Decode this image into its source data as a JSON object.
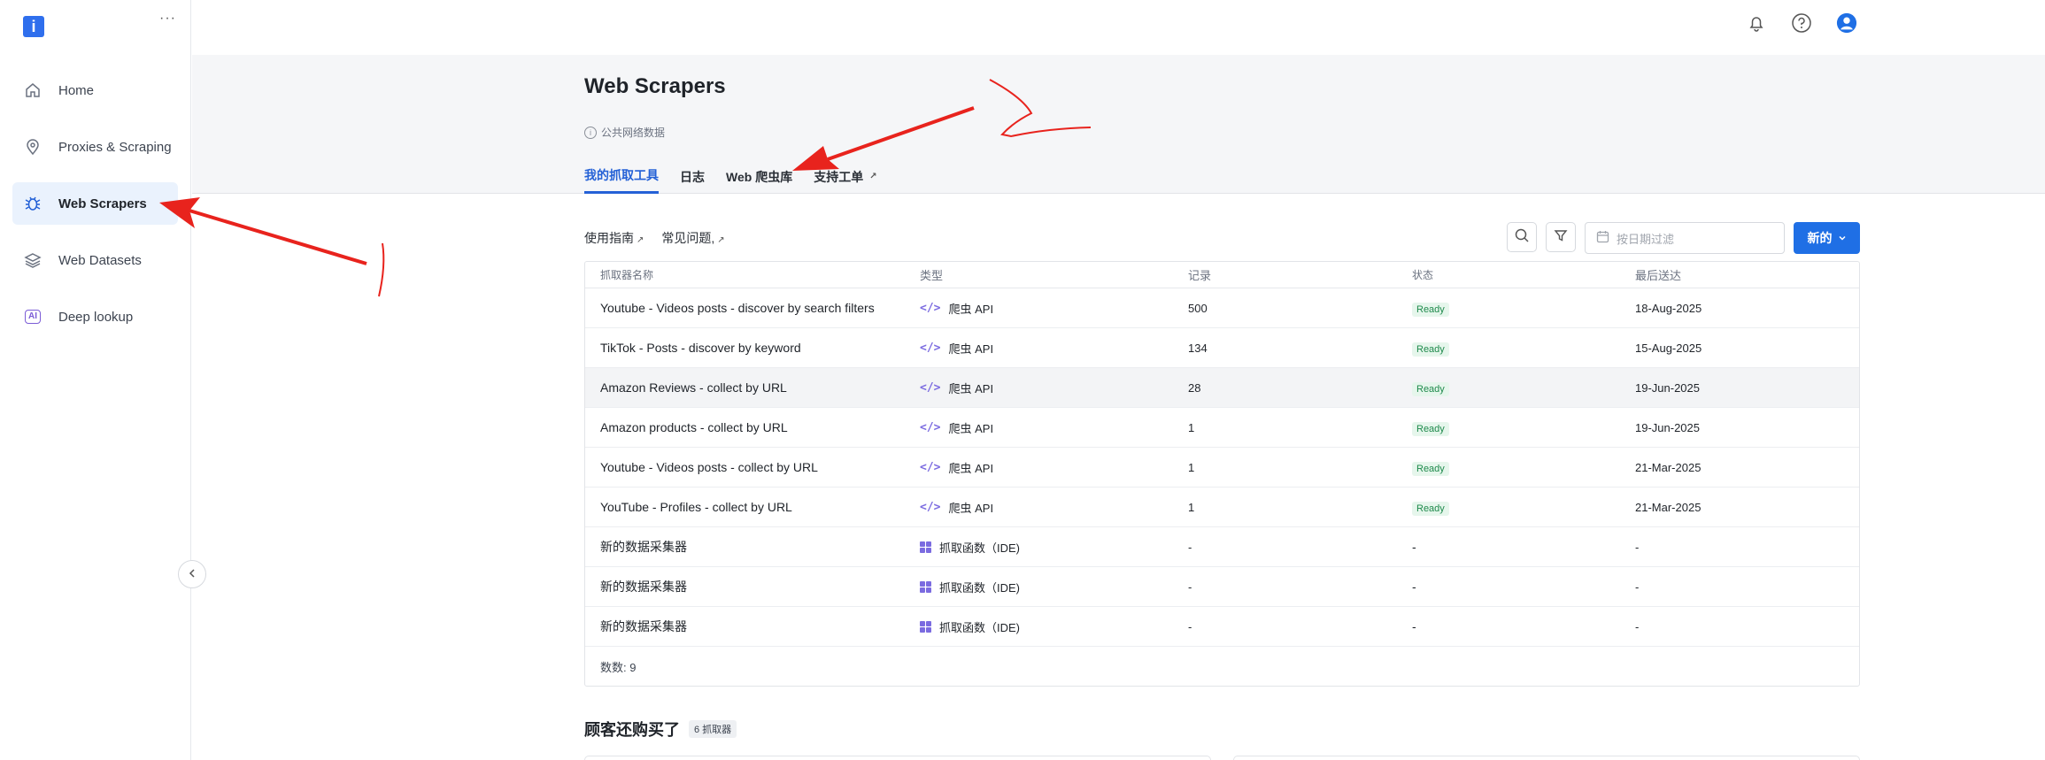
{
  "sidebar": {
    "logo_icon": "info-logo-icon",
    "more_icon": "more-dots-icon",
    "items": [
      {
        "label": "Home",
        "icon": "home-icon",
        "active": false
      },
      {
        "label": "Proxies & Scraping",
        "icon": "location-pin-icon",
        "active": false
      },
      {
        "label": "Web Scrapers",
        "icon": "bug-icon",
        "active": true
      },
      {
        "label": "Web Datasets",
        "icon": "layers-icon",
        "active": false
      },
      {
        "label": "Deep lookup",
        "icon": "ai-icon",
        "active": false
      }
    ],
    "ai_glyph": "AI",
    "collapse_icon": "chevron-left-icon"
  },
  "topbar": {
    "icons": [
      "bell-icon",
      "help-icon",
      "user-avatar-icon"
    ]
  },
  "header": {
    "title": "Web Scrapers",
    "subtitle": "公共网络数据",
    "tabs": [
      {
        "label": "我的抓取工具",
        "active": true,
        "external": false
      },
      {
        "label": "日志",
        "active": false,
        "external": false
      },
      {
        "label": "Web 爬虫库",
        "active": false,
        "external": false
      },
      {
        "label": "支持工单",
        "active": false,
        "external": true
      }
    ]
  },
  "toolbar": {
    "links": [
      "使用指南",
      "常见问题,"
    ],
    "date_placeholder": "按日期过滤",
    "new_label": "新的",
    "accent": "#1f6fe5"
  },
  "table": {
    "columns": [
      "抓取器名称",
      "类型",
      "记录",
      "状态",
      "最后送达"
    ],
    "rows": [
      {
        "name": "Youtube - Videos posts - discover by search filters",
        "type": "爬虫 API",
        "type_icon": "code-icon",
        "records": "500",
        "status": "Ready",
        "last": "18-Aug-2025"
      },
      {
        "name": "TikTok - Posts - discover by keyword",
        "type": "爬虫 API",
        "type_icon": "code-icon",
        "records": "134",
        "status": "Ready",
        "last": "15-Aug-2025"
      },
      {
        "name": "Amazon Reviews - collect by URL",
        "type": "爬虫 API",
        "type_icon": "code-icon",
        "records": "28",
        "status": "Ready",
        "last": "19-Jun-2025"
      },
      {
        "name": "Amazon products - collect by URL",
        "type": "爬虫 API",
        "type_icon": "code-icon",
        "records": "1",
        "status": "Ready",
        "last": "19-Jun-2025"
      },
      {
        "name": "Youtube - Videos posts - collect by URL",
        "type": "爬虫 API",
        "type_icon": "code-icon",
        "records": "1",
        "status": "Ready",
        "last": "21-Mar-2025"
      },
      {
        "name": "YouTube - Profiles - collect by URL",
        "type": "爬虫 API",
        "type_icon": "code-icon",
        "records": "1",
        "status": "Ready",
        "last": "21-Mar-2025"
      },
      {
        "name": "新的数据采集器",
        "type": "抓取函数（IDE)",
        "type_icon": "grid-icon",
        "records": "-",
        "status": "-",
        "last": "-"
      },
      {
        "name": "新的数据采集器",
        "type": "抓取函数（IDE)",
        "type_icon": "grid-icon",
        "records": "-",
        "status": "-",
        "last": "-"
      },
      {
        "name": "新的数据采集器",
        "type": "抓取函数（IDE)",
        "type_icon": "grid-icon",
        "records": "-",
        "status": "-",
        "last": "-"
      }
    ],
    "total": "数数: 9"
  },
  "customers_also_bought": {
    "title": "顾客还购买了",
    "badge": "6 抓取器"
  },
  "annotation_color": "#e8231d"
}
